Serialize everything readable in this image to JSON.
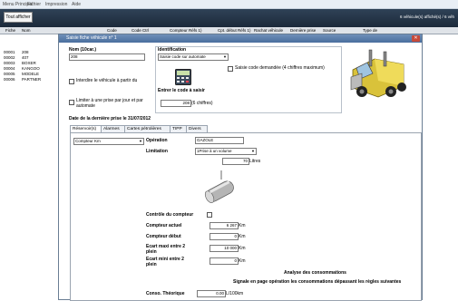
{
  "menu": [
    "Menu Principal",
    "Fichier",
    "Impression",
    "Aide"
  ],
  "toolbar": {
    "tout_afficher": "Tout afficher",
    "count": "6 véhicule(s) affiché(s) / 6 véh"
  },
  "list_headers": [
    "Fiche",
    "Nom",
    "Code",
    "Code Ctrl",
    "Compteur Réfs 1)",
    "Cpt. début Réfs 1)",
    "Rachat véhicule",
    "Dernière prise",
    "Source",
    "Type de"
  ],
  "vehicles": [
    {
      "fiche": "00001",
      "nom": "208"
    },
    {
      "fiche": "00002",
      "nom": "407"
    },
    {
      "fiche": "00003",
      "nom": "BOXER"
    },
    {
      "fiche": "00004",
      "nom": "KANGOO"
    },
    {
      "fiche": "00005",
      "nom": "MODELE"
    },
    {
      "fiche": "00006",
      "nom": "PARTNER"
    }
  ],
  "dialog": {
    "title": "Saisie fiche véhicule n° 1",
    "nom_label": "Nom (10car.)",
    "nom_value": "208",
    "interdire_label": "Interdire le véhicule à partir du",
    "limiter_label_1": "Limiter à une prise par jour et par",
    "limiter_label_2": "automate",
    "identification_label": "Identification",
    "identification_value": "Saisie code sur automate",
    "code_demande_label": "Saisie code demandée (4 chiffres maximum)",
    "entrer_code_label": "Entrer le code à saisir",
    "code_value": "208",
    "code_hint": "(6 chiffres)",
    "derniere_prise": "Date de la dernière prise le 31/07/2012",
    "tabs": [
      "Réservoir(s)",
      "Alarmes",
      "Cartes pétrolières",
      "TIPP",
      "Divers"
    ],
    "compteur_type": "Compteur Km",
    "operation_label": "Opération",
    "operation_value": "GAZOLE",
    "limitation_label": "Limitation",
    "limitation_value": "1Prise à un volume",
    "volume_value": "70",
    "volume_unit": "Litres",
    "controle_label": "Contrôle du compteur",
    "compteur_actuel_label": "Compteur actuel",
    "compteur_actuel_value": "6 267",
    "compteur_debut_label": "Compteur début",
    "compteur_debut_value": "0",
    "ecart_maxi_label_1": "Ecart maxi entre 2",
    "ecart_maxi_label_2": "plein",
    "ecart_maxi_value": "10 000",
    "ecart_mini_label_1": "Ecart mini entre 2",
    "ecart_mini_label_2": "plein",
    "ecart_mini_value": "0",
    "unit_km": "Km",
    "analyse_label": "Analyse des consommations",
    "signale_label": "Signale en page opération les consommations dépassant les règles suivantes",
    "conso_label": "Conso. Théorique",
    "conso_value": "0.00",
    "conso_unit": "L/100km"
  }
}
